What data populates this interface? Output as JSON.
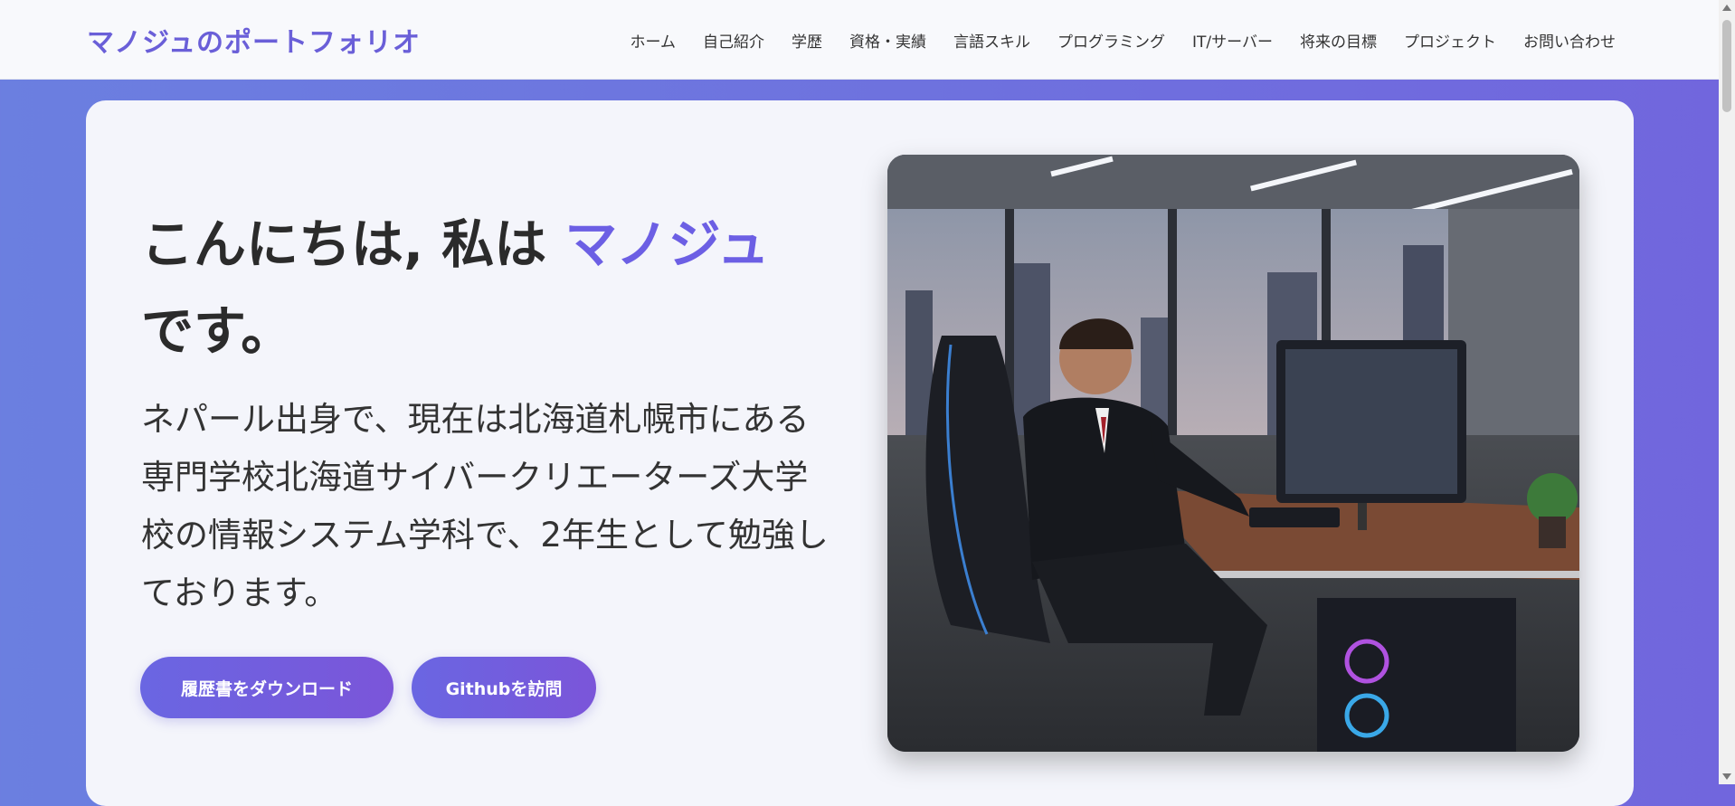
{
  "header": {
    "brand": "マノジュのポートフォリオ",
    "nav": [
      "ホーム",
      "自己紹介",
      "学歴",
      "資格・実績",
      "言語スキル",
      "プログラミング",
      "IT/サーバー",
      "将来の目標",
      "プロジェクト",
      "お問い合わせ"
    ]
  },
  "hero": {
    "greeting_prefix": "こんにちは, 私は ",
    "greeting_name": "マノジュ",
    "greeting_suffix": "です。",
    "intro": "ネパール出身で、現在は北海道札幌市にある専門学校北海道サイバークリエーターズ大学校の情報システム学科で、2年生として勉強しております。",
    "buttons": {
      "resume": "履歴書をダウンロード",
      "github": "Githubを訪問"
    }
  },
  "colors": {
    "accent": "#6c5fe4",
    "background_gradient_start": "#6b7fe0",
    "background_gradient_end": "#7166dd"
  }
}
